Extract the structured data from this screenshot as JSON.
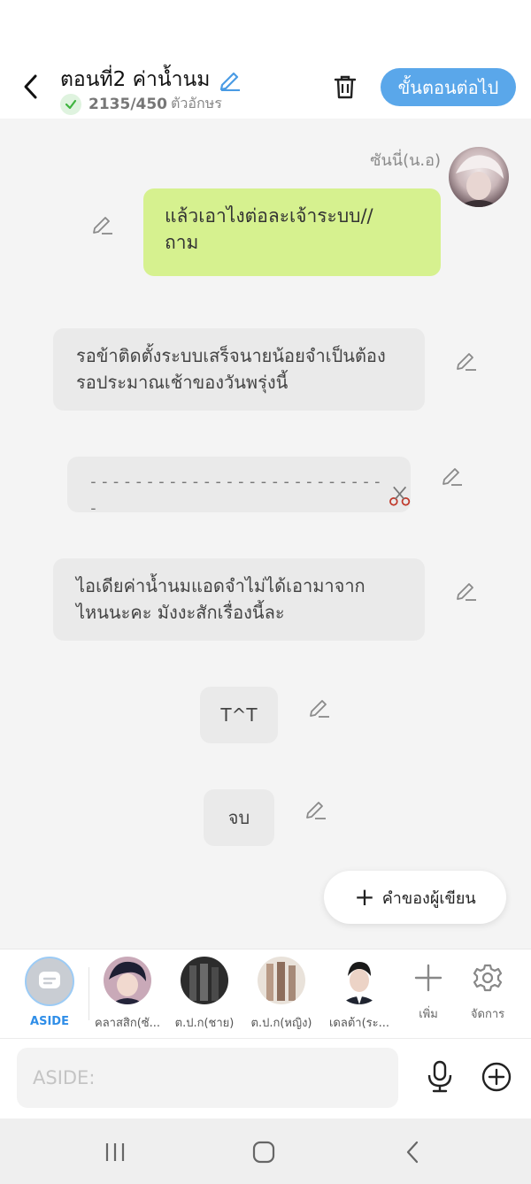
{
  "header": {
    "title": "ตอนที่2 ค่าน้ำนม",
    "char_count": "2135/450",
    "char_unit": "ตัวอักษร",
    "next_button": "ขั้นตอนต่อไป"
  },
  "chat": {
    "sender_name": "ซันนี่(น.อ)",
    "messages": [
      {
        "text_line1": "แล้วเอาไงต่อละเจ้าระบบ//",
        "text_line2": "ถาม"
      },
      {
        "text_line1": "รอข้าติดตั้งระบบเสร็จนายน้อยจำเป็นต้อง",
        "text_line2": "รอประมาณเช้าของวันพรุ่งนี้"
      },
      {
        "text": "---------------------------"
      },
      {
        "text_line1": "ไอเดียค่าน้ำนมแอดจำไม่ได้เอามาจาก",
        "text_line2": "ไหนนะคะ มังงะสักเรื่องนี้ละ"
      },
      {
        "text": "T^T"
      },
      {
        "text": "จบ"
      }
    ],
    "author_button": "คำของผู้เขียน"
  },
  "characters": [
    {
      "label": "ASIDE"
    },
    {
      "label": "คลาสสิก(ซั..."
    },
    {
      "label": "ต.ป.ก(ชาย)"
    },
    {
      "label": "ต.ป.ก(หญิง)"
    },
    {
      "label": "เดลต้า(ระ..."
    }
  ],
  "tools": {
    "add_label": "เพิ่ม",
    "manage_label": "จัดการ"
  },
  "input": {
    "placeholder": "ASIDE:",
    "value": ""
  },
  "colors": {
    "accent": "#5aa7ea",
    "bubble_green": "#d6f18f",
    "bubble_grey": "#eaeaea",
    "aside_label": "#2f8ee8"
  }
}
